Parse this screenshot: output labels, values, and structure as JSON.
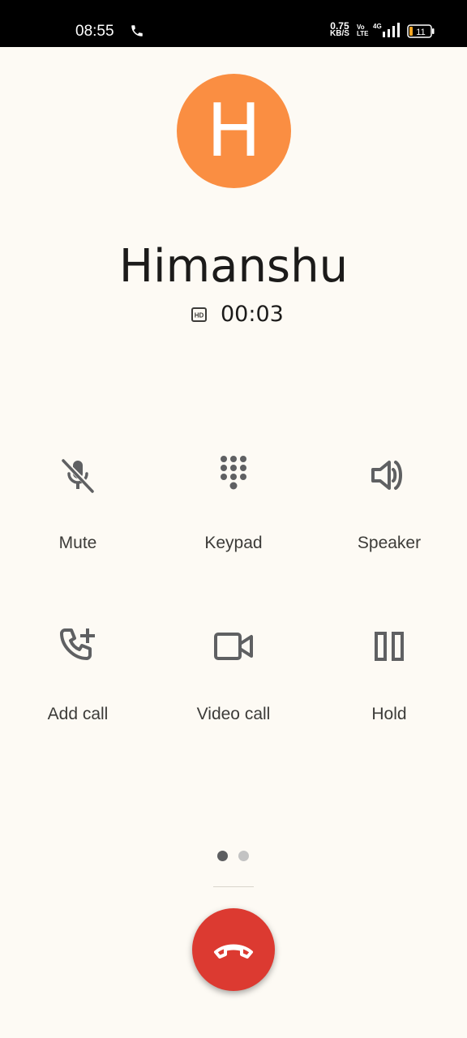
{
  "status_bar": {
    "time": "08:55",
    "net_speed_value": "0.75",
    "net_speed_unit": "KB/S",
    "volte_top": "Vo",
    "volte_bottom": "LTE",
    "network": "4G",
    "battery": "11"
  },
  "caller": {
    "initial": "H",
    "name": "Himanshu",
    "duration": "00:03",
    "avatar_color": "#fa8e42"
  },
  "controls": [
    {
      "label": "Mute",
      "icon": "mic-off-icon"
    },
    {
      "label": "Keypad",
      "icon": "dialpad-icon"
    },
    {
      "label": "Speaker",
      "icon": "volume-icon"
    },
    {
      "label": "Add call",
      "icon": "add-call-icon"
    },
    {
      "label": "Video call",
      "icon": "videocam-icon"
    },
    {
      "label": "Hold",
      "icon": "pause-icon"
    }
  ],
  "pager": {
    "pages": 2,
    "current": 1
  },
  "end_call": {
    "icon": "call-end-icon",
    "color": "#dc3a31"
  }
}
